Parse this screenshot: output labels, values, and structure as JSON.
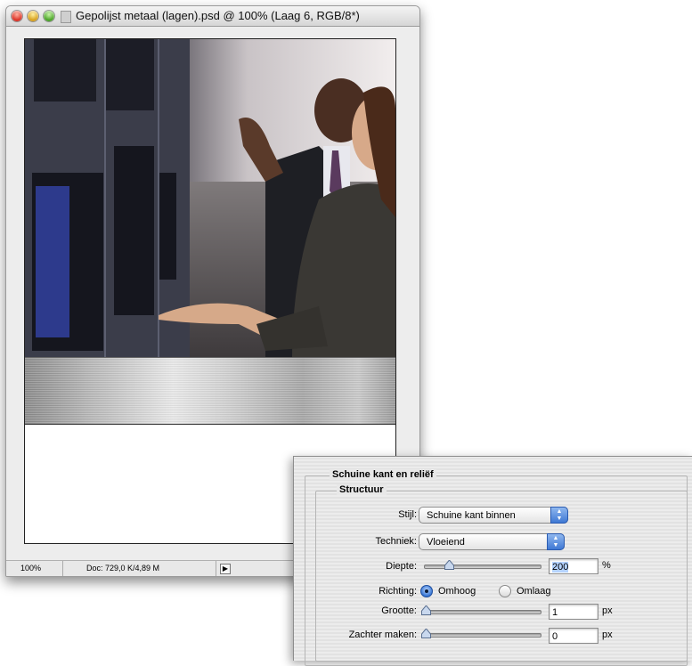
{
  "window": {
    "title": "Gepolijst metaal (lagen).psd @ 100% (Laag 6, RGB/8*)",
    "zoom": "100%",
    "doc_size": "Doc: 729,0 K/4,89 M",
    "status_arrow": "▶"
  },
  "dialog": {
    "group_title": "Schuine kant en reliëf",
    "subgroup_title": "Structuur",
    "style": {
      "label": "Stijl:",
      "value": "Schuine kant binnen"
    },
    "technique": {
      "label": "Techniek:",
      "value": "Vloeiend"
    },
    "depth": {
      "label": "Diepte:",
      "value": "200",
      "unit": "%",
      "slider_fraction": 0.2
    },
    "direction": {
      "label": "Richting:",
      "options": [
        "Omhoog",
        "Omlaag"
      ],
      "selected": "Omhoog"
    },
    "size": {
      "label": "Grootte:",
      "value": "1",
      "unit": "px",
      "slider_fraction": 0.0
    },
    "soften": {
      "label": "Zachter maken:",
      "value": "0",
      "unit": "px",
      "slider_fraction": 0.0
    }
  },
  "colors": {
    "radio_selected": "#2f6fd1",
    "popup_arrow": "#3f78d4",
    "value_highlight": "#b5d3ff"
  }
}
